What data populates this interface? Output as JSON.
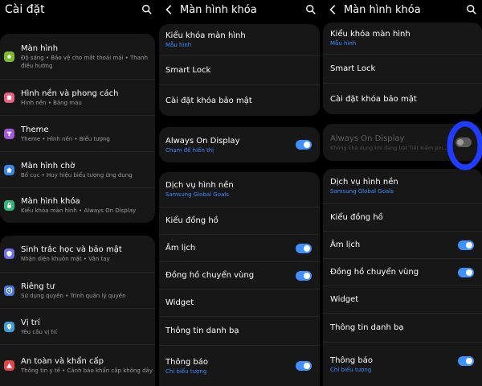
{
  "panel1": {
    "title": "Cài đặt",
    "groups": [
      [
        {
          "title": "Màn hình",
          "sub": "Độ sáng • Bảo vệ cho mắt thoải mái • Thanh điều hướng",
          "icon": "display-icon",
          "color": "#7dbb2c"
        },
        {
          "title": "Hình nền và phong cách",
          "sub": "Hình nền • Bảng màu",
          "icon": "wallpaper-icon",
          "color": "#e95d83"
        },
        {
          "title": "Theme",
          "sub": "Theme • Hình nền • Biểu tượng",
          "icon": "theme-icon",
          "color": "#a358d8"
        },
        {
          "title": "Màn hình chờ",
          "sub": "Bố cục • Huy hiệu biểu tượng ứng dụng",
          "icon": "home-icon",
          "color": "#3b83e6"
        },
        {
          "title": "Màn hình khóa",
          "sub": "Kiểu khóa màn hình • Always On Display",
          "icon": "lock-icon",
          "color": "#3ab27b"
        }
      ],
      [
        {
          "title": "Sinh trắc học và bảo mật",
          "sub": "Nhận diện khuôn mặt • Vân tay",
          "icon": "shield-icon",
          "color": "#6b6de0"
        },
        {
          "title": "Riêng tư",
          "sub": "Sử dụng quyền • Trình quản lý quyền",
          "icon": "privacy-icon",
          "color": "#4877e3"
        },
        {
          "title": "Vị trí",
          "sub": "Yêu cầu vị trí",
          "icon": "location-icon",
          "color": "#3fa0d8"
        },
        {
          "title": "An toàn và khẩn cấp",
          "sub": "Thông tin y tế • Cảnh báo khẩn cấp không dây",
          "icon": "emergency-icon",
          "color": "#e0484d"
        }
      ]
    ]
  },
  "panel2": {
    "title": "Màn hình khóa",
    "groups": [
      [
        {
          "title": "Kiểu khóa màn hình",
          "sub": "Mẫu hình"
        },
        {
          "title": "Smart Lock"
        },
        {
          "title": "Cài đặt khóa bảo mật"
        }
      ],
      [
        {
          "title": "Always On Display",
          "sub": "Chạm để hiển thị",
          "toggle": true
        }
      ],
      [
        {
          "title": "Dịch vụ hình nền",
          "sub": "Samsung Global Goals"
        },
        {
          "title": "Kiểu đồng hồ"
        },
        {
          "title": "Âm lịch",
          "toggle": true
        },
        {
          "title": "Đồng hồ chuyển vùng",
          "toggle": true
        },
        {
          "title": "Widget"
        },
        {
          "title": "Thông tin danh bạ"
        },
        {
          "title": "Thông báo",
          "sub": "Chỉ biểu tượng",
          "toggle": true
        }
      ]
    ]
  },
  "panel3": {
    "title": "Màn hình khóa",
    "groups": [
      [
        {
          "title": "Kiểu khóa màn hình",
          "sub": "Mẫu hình"
        },
        {
          "title": "Smart Lock"
        },
        {
          "title": "Cài đặt khóa bảo mật"
        }
      ],
      [
        {
          "title": "Always On Display",
          "sub": "Không khả dụng khi đang bật Tiết kiệm pin...",
          "toggle": false,
          "dim": true
        }
      ],
      [
        {
          "title": "Dịch vụ hình nền",
          "sub": "Samsung Global Goals"
        },
        {
          "title": "Kiểu đồng hồ"
        },
        {
          "title": "Âm lịch",
          "toggle": true
        },
        {
          "title": "Đồng hồ chuyển vùng",
          "toggle": true
        },
        {
          "title": "Widget"
        },
        {
          "title": "Thông tin danh bạ"
        },
        {
          "title": "Thông báo",
          "sub": "Chỉ biểu tượng",
          "toggle": true
        }
      ]
    ]
  },
  "colors": {
    "accent": "#3e91ff",
    "highlight_circle": "#1f3cff"
  }
}
